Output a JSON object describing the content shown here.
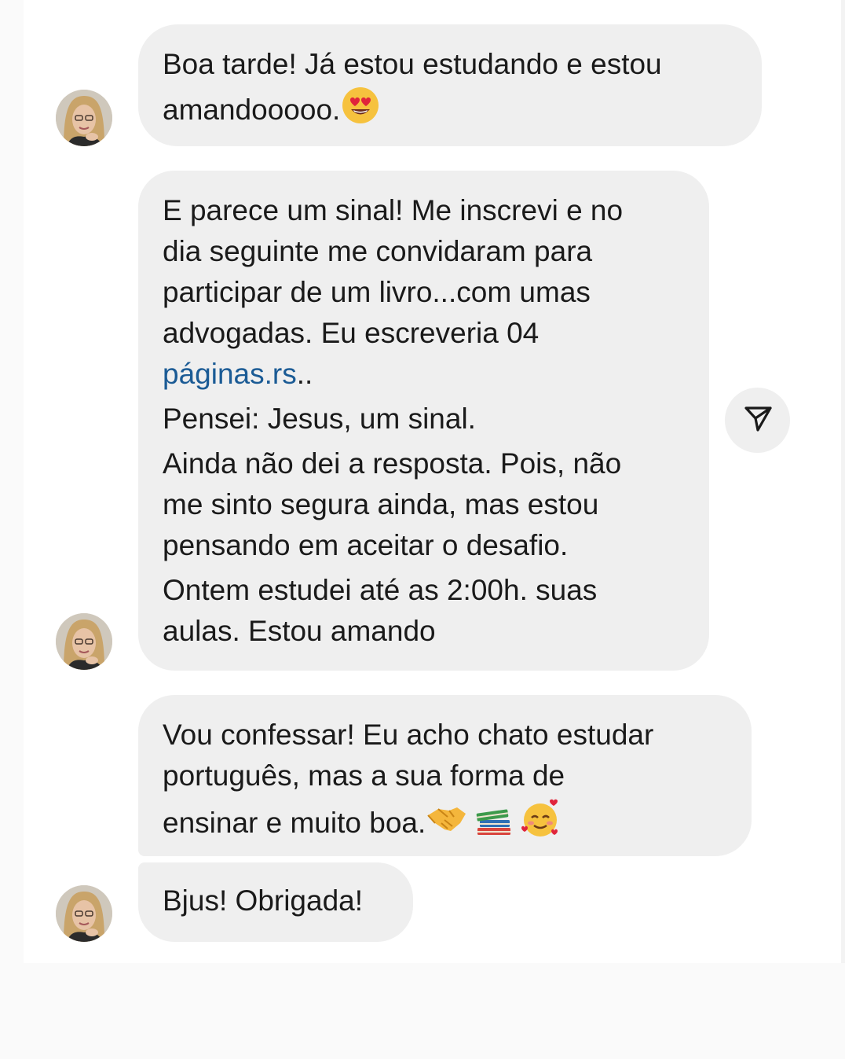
{
  "messages": [
    {
      "id": "msg1",
      "lines": [
        "Boa tarde! Já estou estudando e estou",
        "amandooooo."
      ],
      "emojis": [
        "heart-eyes-emoji"
      ]
    },
    {
      "id": "msg2",
      "paragraph1": [
        "E parece um sinal! Me inscrevi e no",
        "dia seguinte me convidaram para",
        "participar de um livro...com umas",
        "advogadas. Eu escreveria 04"
      ],
      "link_text": "páginas.rs",
      "link_suffix": "..",
      "paragraph2": "Pensei: Jesus, um sinal.",
      "paragraph3": [
        "Ainda não dei a resposta. Pois, não",
        "me sinto segura ainda, mas estou",
        "pensando em aceitar o desafio."
      ],
      "paragraph4": [
        "Ontem estudei até as 2:00h. suas",
        "aulas. Estou amando"
      ]
    },
    {
      "id": "msg3",
      "lines": [
        "Vou confessar! Eu acho chato estudar",
        "português, mas a sua forma de",
        "ensinar e muito boa."
      ],
      "emojis": [
        "handshake-emoji",
        "books-emoji",
        "smiling-hearts-emoji"
      ]
    },
    {
      "id": "msg4",
      "lines": [
        "Bjus! Obrigada!"
      ]
    }
  ],
  "share_button": {
    "icon": "paper-plane-icon"
  },
  "colors": {
    "bubble": "#efefef",
    "text": "#1a1a1a",
    "link": "#1b5b95",
    "background": "#ffffff"
  }
}
